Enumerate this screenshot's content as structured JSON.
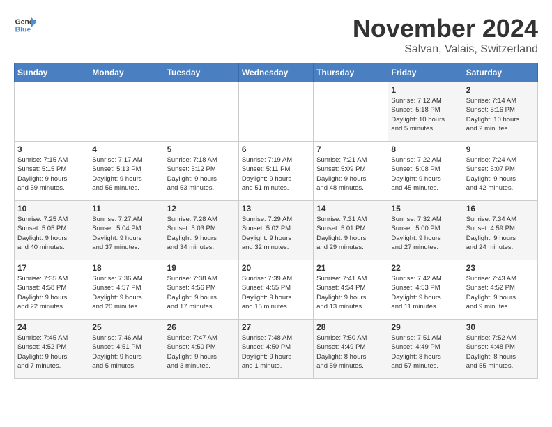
{
  "logo": {
    "line1": "General",
    "line2": "Blue"
  },
  "title": "November 2024",
  "location": "Salvan, Valais, Switzerland",
  "weekdays": [
    "Sunday",
    "Monday",
    "Tuesday",
    "Wednesday",
    "Thursday",
    "Friday",
    "Saturday"
  ],
  "weeks": [
    [
      {
        "day": "",
        "info": ""
      },
      {
        "day": "",
        "info": ""
      },
      {
        "day": "",
        "info": ""
      },
      {
        "day": "",
        "info": ""
      },
      {
        "day": "",
        "info": ""
      },
      {
        "day": "1",
        "info": "Sunrise: 7:12 AM\nSunset: 5:18 PM\nDaylight: 10 hours\nand 5 minutes."
      },
      {
        "day": "2",
        "info": "Sunrise: 7:14 AM\nSunset: 5:16 PM\nDaylight: 10 hours\nand 2 minutes."
      }
    ],
    [
      {
        "day": "3",
        "info": "Sunrise: 7:15 AM\nSunset: 5:15 PM\nDaylight: 9 hours\nand 59 minutes."
      },
      {
        "day": "4",
        "info": "Sunrise: 7:17 AM\nSunset: 5:13 PM\nDaylight: 9 hours\nand 56 minutes."
      },
      {
        "day": "5",
        "info": "Sunrise: 7:18 AM\nSunset: 5:12 PM\nDaylight: 9 hours\nand 53 minutes."
      },
      {
        "day": "6",
        "info": "Sunrise: 7:19 AM\nSunset: 5:11 PM\nDaylight: 9 hours\nand 51 minutes."
      },
      {
        "day": "7",
        "info": "Sunrise: 7:21 AM\nSunset: 5:09 PM\nDaylight: 9 hours\nand 48 minutes."
      },
      {
        "day": "8",
        "info": "Sunrise: 7:22 AM\nSunset: 5:08 PM\nDaylight: 9 hours\nand 45 minutes."
      },
      {
        "day": "9",
        "info": "Sunrise: 7:24 AM\nSunset: 5:07 PM\nDaylight: 9 hours\nand 42 minutes."
      }
    ],
    [
      {
        "day": "10",
        "info": "Sunrise: 7:25 AM\nSunset: 5:05 PM\nDaylight: 9 hours\nand 40 minutes."
      },
      {
        "day": "11",
        "info": "Sunrise: 7:27 AM\nSunset: 5:04 PM\nDaylight: 9 hours\nand 37 minutes."
      },
      {
        "day": "12",
        "info": "Sunrise: 7:28 AM\nSunset: 5:03 PM\nDaylight: 9 hours\nand 34 minutes."
      },
      {
        "day": "13",
        "info": "Sunrise: 7:29 AM\nSunset: 5:02 PM\nDaylight: 9 hours\nand 32 minutes."
      },
      {
        "day": "14",
        "info": "Sunrise: 7:31 AM\nSunset: 5:01 PM\nDaylight: 9 hours\nand 29 minutes."
      },
      {
        "day": "15",
        "info": "Sunrise: 7:32 AM\nSunset: 5:00 PM\nDaylight: 9 hours\nand 27 minutes."
      },
      {
        "day": "16",
        "info": "Sunrise: 7:34 AM\nSunset: 4:59 PM\nDaylight: 9 hours\nand 24 minutes."
      }
    ],
    [
      {
        "day": "17",
        "info": "Sunrise: 7:35 AM\nSunset: 4:58 PM\nDaylight: 9 hours\nand 22 minutes."
      },
      {
        "day": "18",
        "info": "Sunrise: 7:36 AM\nSunset: 4:57 PM\nDaylight: 9 hours\nand 20 minutes."
      },
      {
        "day": "19",
        "info": "Sunrise: 7:38 AM\nSunset: 4:56 PM\nDaylight: 9 hours\nand 17 minutes."
      },
      {
        "day": "20",
        "info": "Sunrise: 7:39 AM\nSunset: 4:55 PM\nDaylight: 9 hours\nand 15 minutes."
      },
      {
        "day": "21",
        "info": "Sunrise: 7:41 AM\nSunset: 4:54 PM\nDaylight: 9 hours\nand 13 minutes."
      },
      {
        "day": "22",
        "info": "Sunrise: 7:42 AM\nSunset: 4:53 PM\nDaylight: 9 hours\nand 11 minutes."
      },
      {
        "day": "23",
        "info": "Sunrise: 7:43 AM\nSunset: 4:52 PM\nDaylight: 9 hours\nand 9 minutes."
      }
    ],
    [
      {
        "day": "24",
        "info": "Sunrise: 7:45 AM\nSunset: 4:52 PM\nDaylight: 9 hours\nand 7 minutes."
      },
      {
        "day": "25",
        "info": "Sunrise: 7:46 AM\nSunset: 4:51 PM\nDaylight: 9 hours\nand 5 minutes."
      },
      {
        "day": "26",
        "info": "Sunrise: 7:47 AM\nSunset: 4:50 PM\nDaylight: 9 hours\nand 3 minutes."
      },
      {
        "day": "27",
        "info": "Sunrise: 7:48 AM\nSunset: 4:50 PM\nDaylight: 9 hours\nand 1 minute."
      },
      {
        "day": "28",
        "info": "Sunrise: 7:50 AM\nSunset: 4:49 PM\nDaylight: 8 hours\nand 59 minutes."
      },
      {
        "day": "29",
        "info": "Sunrise: 7:51 AM\nSunset: 4:49 PM\nDaylight: 8 hours\nand 57 minutes."
      },
      {
        "day": "30",
        "info": "Sunrise: 7:52 AM\nSunset: 4:48 PM\nDaylight: 8 hours\nand 55 minutes."
      }
    ]
  ]
}
